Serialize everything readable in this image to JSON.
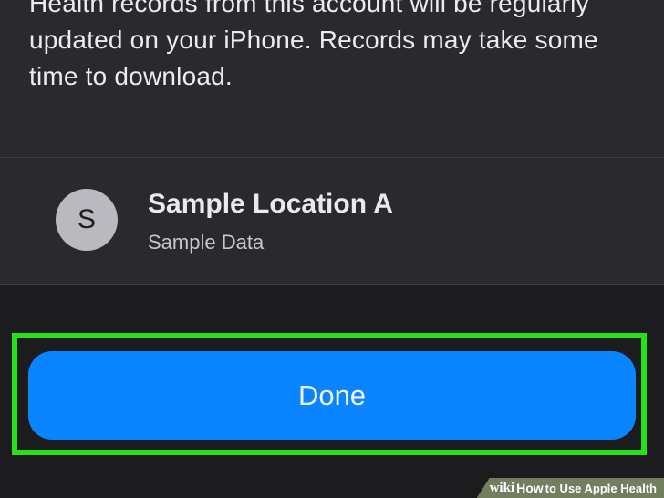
{
  "consent": {
    "description": "Health records from this account will be regularly updated on your iPhone. Records may take some time to download."
  },
  "location": {
    "avatar_initial": "S",
    "name": "Sample Location A",
    "subtitle": "Sample Data"
  },
  "actions": {
    "done_label": "Done",
    "highlight_color": "#27e21b",
    "button_color": "#0a84ff"
  },
  "watermark": {
    "brand": "wiki",
    "how": "How",
    "title": " to Use Apple Health"
  }
}
